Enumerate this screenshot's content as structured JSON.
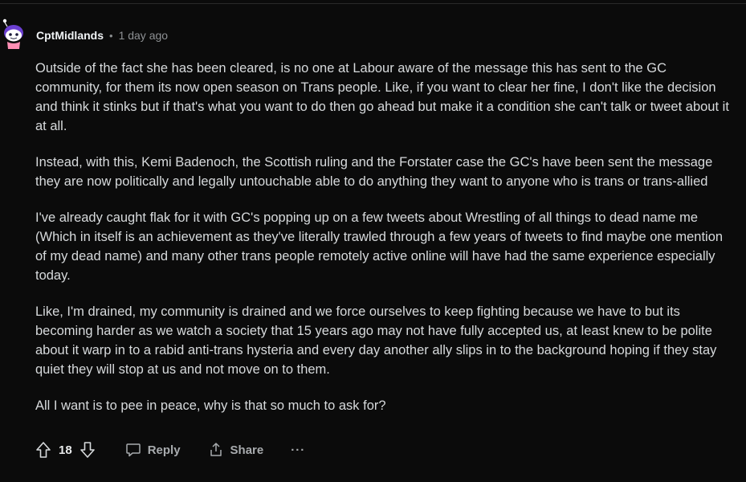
{
  "comment": {
    "username": "CptMidlands",
    "separator": "•",
    "timestamp": "1 day ago",
    "paragraphs": [
      "Outside of the fact she has been cleared, is no one at Labour aware of the message this has sent to the GC community, for them its now open season on Trans people. Like, if you want to clear her fine, I don't like the decision and think it stinks but if that's what you want to do then go ahead but make it a condition she can't talk or tweet about it at all.",
      "Instead, with this, Kemi Badenoch, the Scottish ruling and the Forstater case the GC's have been sent the message they are now politically and legally untouchable able to do anything they want to anyone who is trans or trans-allied",
      "I've already caught flak for it with GC's popping up on a few tweets about Wrestling of all things to dead name me (Which in itself is an achievement as they've literally trawled through a few years of tweets to find maybe one mention of my dead name) and many other trans people remotely active online will have had the same experience especially today.",
      "Like, I'm drained, my community is drained and we force ourselves to keep fighting because we have to but its becoming harder as we watch a society that 15 years ago may not have fully accepted us, at least knew to be polite about it warp in to a rabid anti-trans hysteria and every day another ally slips in to the background hoping if they stay quiet they will stop at us and not move on to them.",
      "All I want is to pee in peace, why is that so much to ask for?"
    ],
    "score": "18",
    "actions": {
      "reply_label": "Reply",
      "share_label": "Share",
      "more_label": "···"
    },
    "icons": {
      "avatar": "snoo-avatar",
      "upvote": "upvote-arrow-icon",
      "downvote": "downvote-arrow-icon",
      "reply": "speech-bubble-icon",
      "share": "share-icon"
    }
  },
  "colors": {
    "background": "#0b0b0b",
    "text": "#d7dadc",
    "muted": "#a8abae",
    "avatar_accent": "#6b3fd1"
  }
}
